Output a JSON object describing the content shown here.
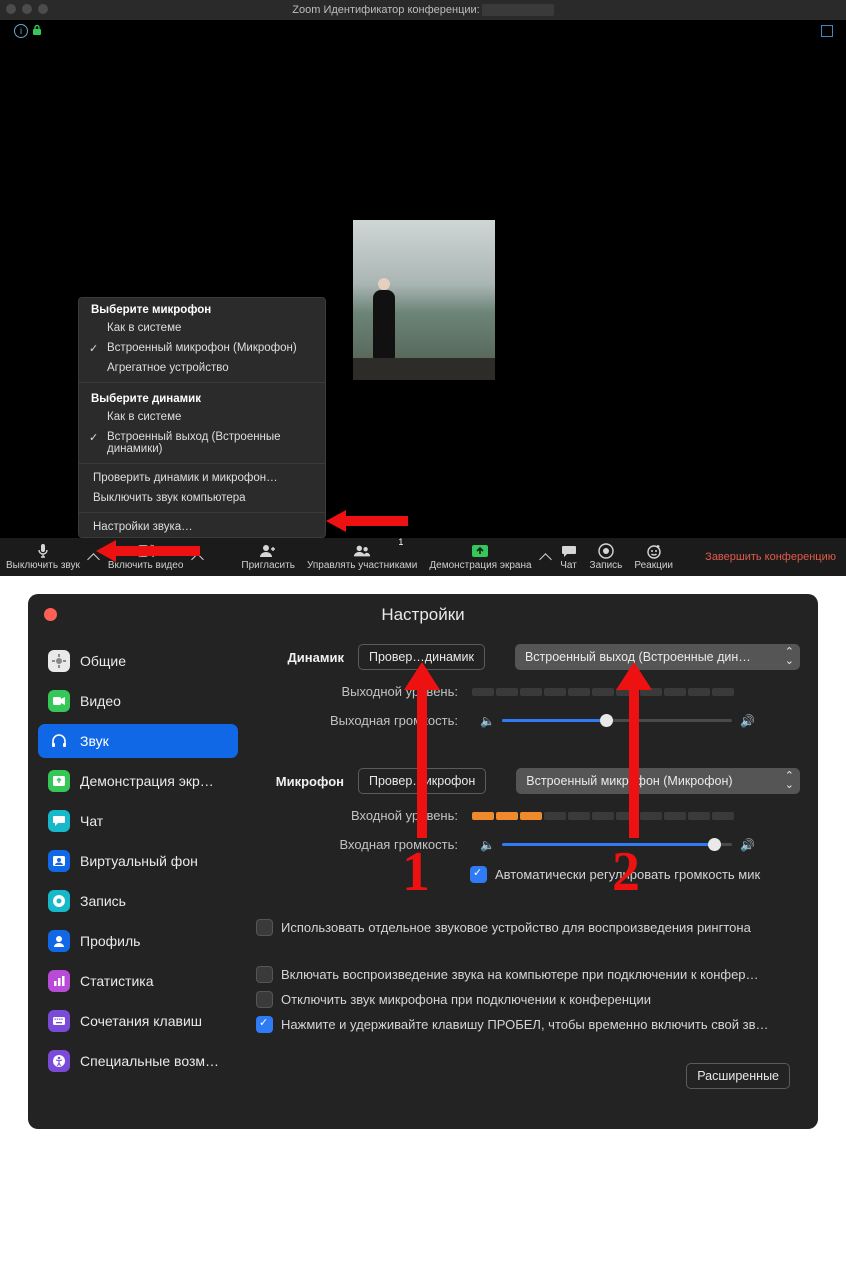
{
  "screen1": {
    "title_prefix": "Zoom Идентификатор конференции:",
    "toolbar": {
      "mute": {
        "label": "Выключить звук"
      },
      "video": {
        "label": "Включить видео"
      },
      "invite": {
        "label": "Пригласить"
      },
      "participants": {
        "label": "Управлять участниками",
        "count": "1"
      },
      "share": {
        "label": "Демонстрация экрана"
      },
      "chat": {
        "label": "Чат"
      },
      "record": {
        "label": "Запись"
      },
      "reactions": {
        "label": "Реакции"
      },
      "leave": {
        "label": "Завершить конференцию"
      }
    },
    "mic_menu": {
      "mic_header": "Выберите микрофон",
      "mic_items": [
        "Как в системе",
        "Встроенный микрофон (Микрофон)",
        "Агрегатное устройство"
      ],
      "mic_selected_index": 1,
      "spk_header": "Выберите динамик",
      "spk_items": [
        "Как в системе",
        "Встроенный выход (Встроенные динамики)"
      ],
      "spk_selected_index": 1,
      "test": "Проверить динамик и микрофон…",
      "mute_pc": "Выключить звук компьютера",
      "audio_settings": "Настройки звука…"
    }
  },
  "screen2": {
    "title": "Настройки",
    "sidebar": {
      "general": "Общие",
      "video": "Видео",
      "audio": "Звук",
      "share": "Демонстрация экр…",
      "chat": "Чат",
      "vbg": "Виртуальный фон",
      "record": "Запись",
      "profile": "Профиль",
      "stats": "Статистика",
      "keys": "Сочетания клавиш",
      "acc": "Специальные возм…"
    },
    "speaker": {
      "label": "Динамик",
      "test_btn": "Провер…динамик",
      "device": "Встроенный выход (Встроенные дин…",
      "out_level_label": "Выходной уровень:",
      "out_volume_label": "Выходная громкость:",
      "level_on_segments": 0,
      "volume_percent": 45
    },
    "mic": {
      "label": "Микрофон",
      "test_btn": "Провер…икрофон",
      "device": "Встроенный микрофон (Микрофон)",
      "in_level_label": "Входной уровень:",
      "in_volume_label": "Входная громкость:",
      "level_on_segments": 3,
      "volume_percent": 92,
      "auto_adjust": "Автоматически регулировать громкость мик"
    },
    "opts": {
      "ringtone": "Использовать отдельное звуковое устройство для воспроизведения рингтона",
      "join_audio": "Включать воспроизведение звука на компьютере при подключении к конфер…",
      "mute_on_join": "Отключить звук микрофона при подключении к конференции",
      "push_to_talk": "Нажмите и удерживайте клавишу ПРОБЕЛ, чтобы временно включить свой зв…",
      "advanced": "Расширенные"
    },
    "annotations": {
      "num1": "1",
      "num2": "2"
    }
  }
}
